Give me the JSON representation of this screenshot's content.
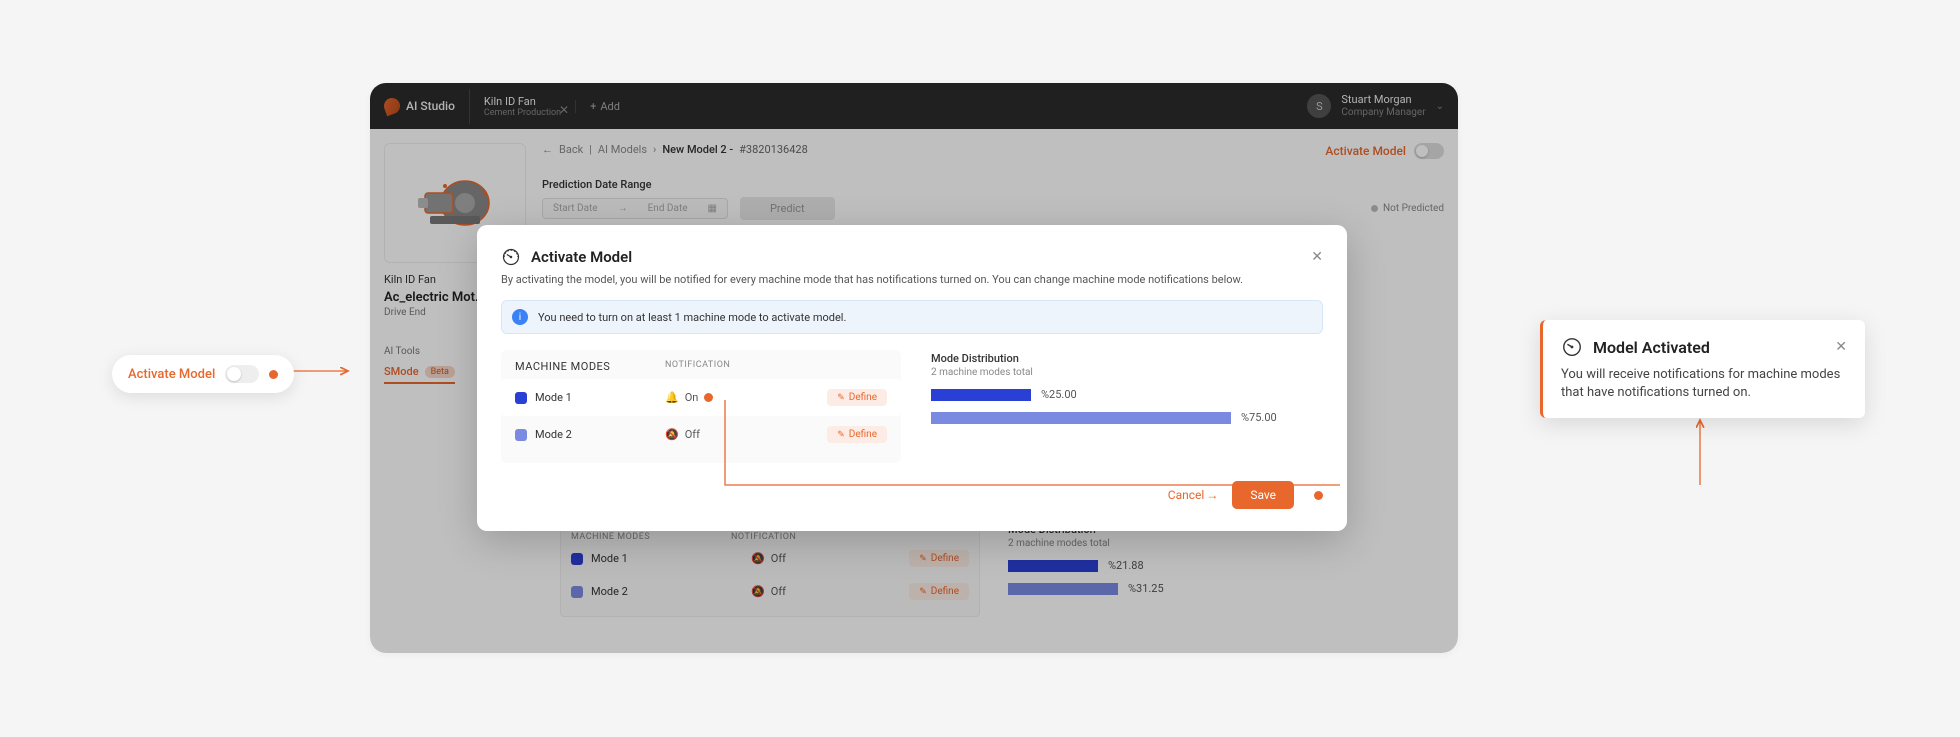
{
  "brand": "AI Studio",
  "tab": {
    "title": "Kiln ID Fan",
    "subtitle": "Cement Production"
  },
  "addTab": "Add",
  "user": {
    "initial": "S",
    "name": "Stuart Morgan",
    "role": "Company Manager"
  },
  "sidebar": {
    "title": "Kiln ID Fan",
    "main": "Ac_electric Mot…",
    "sub": "Drive End",
    "aiTools": "AI Tools",
    "smode": "SMode",
    "beta": "Beta"
  },
  "crumbs": {
    "back": "Back",
    "aiModels": "AI Models",
    "current": "New Model 2 -",
    "hash": "#3820136428"
  },
  "activateModelLabel": "Activate Model",
  "predRange": {
    "label": "Prediction Date Range",
    "start": "Start Date",
    "end": "End Date",
    "predict": "Predict"
  },
  "notPredicted": "Not Predicted",
  "tableHeaders": {
    "modes": "MACHINE MODES",
    "notif": "NOTIFICATION"
  },
  "modes": {
    "m1": "Mode 1",
    "m2": "Mode 2"
  },
  "notifStates": {
    "on": "On",
    "off": "Off"
  },
  "defineBtn": "Define",
  "dist": {
    "title": "Mode Distribution",
    "sub": "2 machine modes total"
  },
  "modal": {
    "title": "Activate Model",
    "desc": "By activating the model, you will be notified for every machine mode that has notifications turned on. You can change machine mode notifications below.",
    "info": "You need to turn on at least 1 machine mode to activate model.",
    "pct1": "%25.00",
    "pct2": "%75.00",
    "cancel": "Cancel",
    "save": "Save"
  },
  "lower": {
    "pct1": "%21.88",
    "pct2": "%31.25"
  },
  "toast": {
    "title": "Model Activated",
    "body": "You will receive notifications for machine modes that have notifications turned on."
  },
  "chart_data": [
    {
      "type": "bar",
      "title": "Mode Distribution",
      "subtitle": "2 machine modes total",
      "context": "modal",
      "categories": [
        "Mode 1",
        "Mode 2"
      ],
      "values": [
        25.0,
        75.0
      ],
      "unit": "%"
    },
    {
      "type": "bar",
      "title": "Mode Distribution",
      "subtitle": "2 machine modes total",
      "context": "background-panel",
      "categories": [
        "Mode 1",
        "Mode 2"
      ],
      "values": [
        21.88,
        31.25
      ],
      "unit": "%"
    }
  ]
}
